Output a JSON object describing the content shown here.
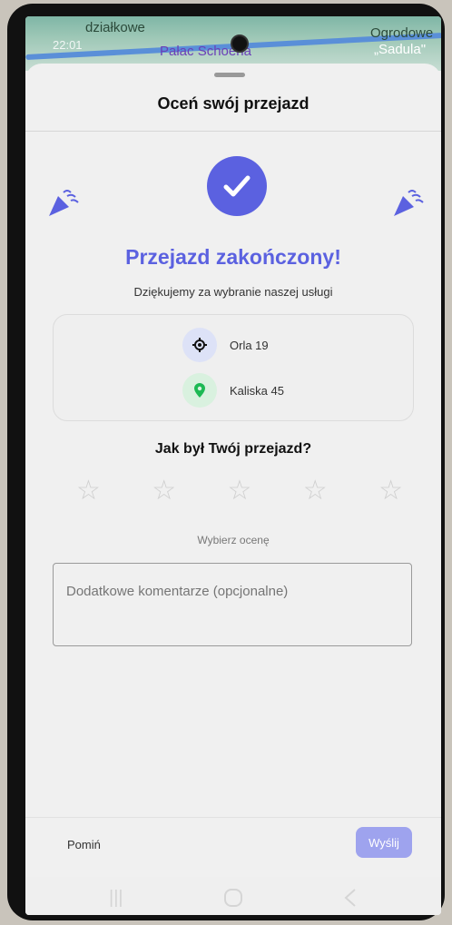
{
  "map": {
    "place_1": "działkowe",
    "place_2": "Pałac Schoena",
    "place_3": "Ogrodowe",
    "place_4": "„Sadula\"",
    "status_time": "22:01"
  },
  "sheet": {
    "title": "Oceń swój przejazd",
    "done_title": "Przejazd zakończony!",
    "done_subtitle": "Dziękujemy za wybranie naszej usługi"
  },
  "route": {
    "origin": "Orla 19",
    "destination": "Kaliska 45",
    "origin_icon": "target-icon",
    "destination_icon": "map-pin-icon"
  },
  "rating": {
    "question": "Jak był Twój przejazd?",
    "stars": [
      "☆",
      "☆",
      "☆",
      "☆",
      "☆"
    ],
    "hint": "Wybierz ocenę",
    "selected": 0
  },
  "comment": {
    "placeholder": "Dodatkowe komentarze (opcjonalne)"
  },
  "actions": {
    "skip": "Pomiń",
    "send": "Wyślij"
  },
  "colors": {
    "accent": "#5b61e0",
    "accent_disabled": "#9ea3ee",
    "origin_bg": "#dde2f7",
    "destination_bg": "#d9f1df",
    "destination_pin": "#1db954"
  }
}
